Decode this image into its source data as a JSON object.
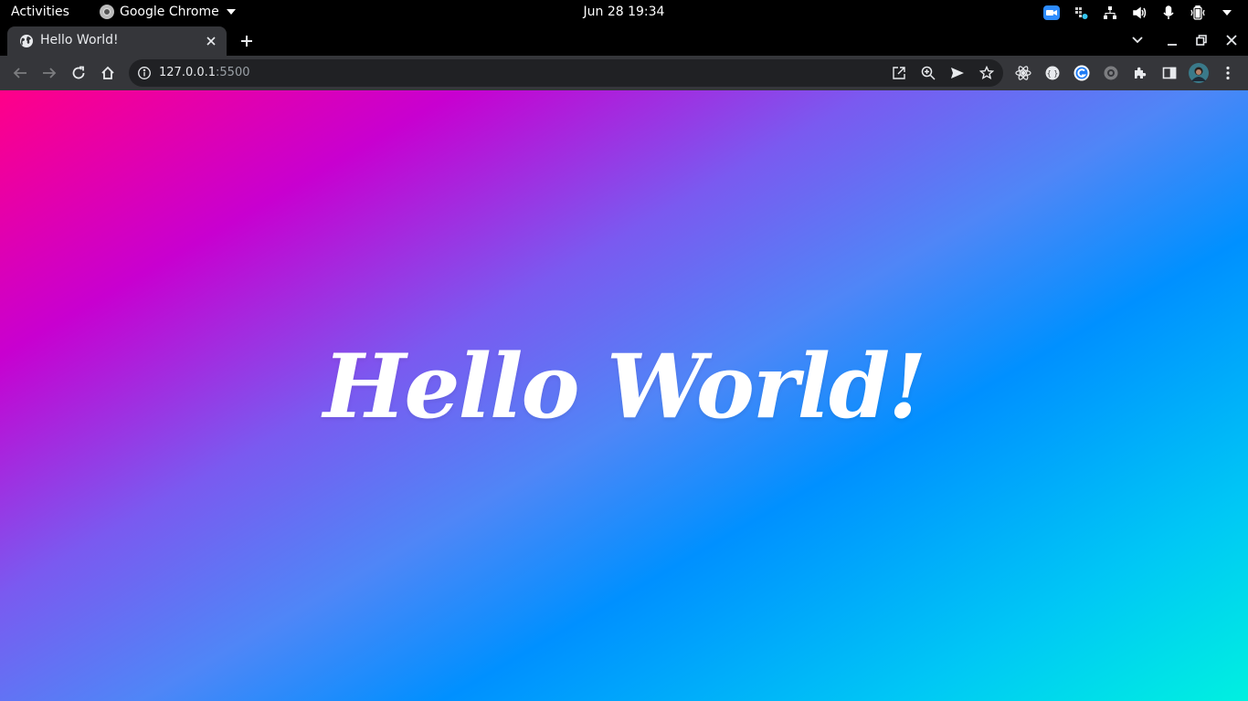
{
  "topbar": {
    "activities": "Activities",
    "app_name": "Google Chrome",
    "clock": "Jun 28  19:34",
    "tray_icons": [
      "zoom-icon",
      "slack-icon",
      "network-icon",
      "volume-icon",
      "microphone-icon",
      "battery-icon",
      "power-menu-icon"
    ]
  },
  "browser": {
    "tab": {
      "title": "Hello World!",
      "favicon": "globe-icon"
    },
    "omnibox": {
      "host": "127.0.0.1",
      "port": ":5500"
    },
    "extensions": [
      "react-devtools-icon",
      "extension-icon",
      "grammarly-icon",
      "extension-icon",
      "puzzle-icon",
      "side-panel-icon",
      "profile-avatar",
      "more-menu-icon"
    ]
  },
  "page": {
    "heading": "Hello World!",
    "gradient_colors": [
      "#ff0088",
      "#c800d0",
      "#7a5af0",
      "#0090ff",
      "#00f0e0"
    ]
  }
}
